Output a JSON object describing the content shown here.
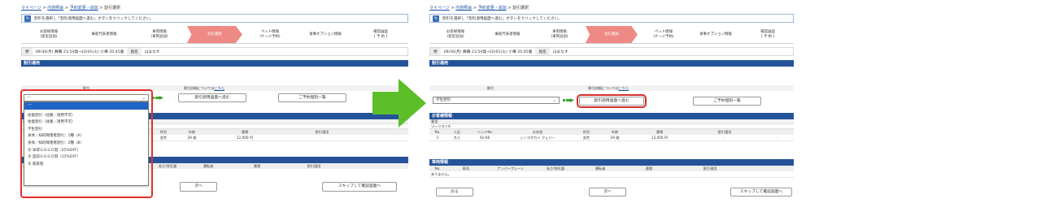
{
  "breadcrumb": {
    "items": [
      "マイページ",
      "内容照会",
      "予約変更・追加",
      "割引選択"
    ],
    "separator": ">"
  },
  "notice": "割引を選択し「割引適用画面へ進む」ボタンをクリックしてください。",
  "steps": [
    {
      "line1": "お客様情報",
      "line2": "(客室追加)"
    },
    {
      "line1": "乗船代表者情報",
      "line2": ""
    },
    {
      "line1": "車両情報",
      "line2": "(車両追加)"
    },
    {
      "line1": "割引選択",
      "line2": ""
    },
    {
      "line1": "ペット情報",
      "line2": "(ケージ予約)"
    },
    {
      "line1": "食事オプション情報",
      "line2": ""
    },
    {
      "line1": "確認画面",
      "line2": "[ 予 約 ]"
    }
  ],
  "trip": {
    "label": "便",
    "schedule": "09/30(月) 舞鶴 23:50発→10/01(火) 小樽 20:45着",
    "ship_label": "船名",
    "ship_name": "はまなす"
  },
  "discount_section": {
    "title": "割引適用",
    "col_discount": "割引",
    "detail_text": "割引詳細については",
    "detail_link": "こちら",
    "apply_button": "割引適用画面へ進む",
    "list_button": "ご予約個別一覧",
    "left_select_value": "---",
    "right_select_value": "学生割引"
  },
  "dropdown_options": [
    "---",
    "往復割引（往路／適用不可）",
    "往復割引（往路／適用不可）",
    "学生割引",
    "身体／知的障害者割引：1種（A）",
    "身体／知的障害者割引：2種（B）",
    "㊟ 早得ＧＯＧＯ割（25%OFF）",
    "㊟ 直前ＧＯＧＯ割（15%OFF）",
    "㊟ 家族割"
  ],
  "customer_section": {
    "title": "お客様情報",
    "room_label": "客室",
    "room_type": "ツーリストA",
    "headers": [
      "No.",
      "人区",
      "ベッドNo",
      "お名前",
      "性別",
      "年齢",
      "運賃",
      "割引適用"
    ],
    "rows": [
      [
        "1",
        "大人",
        "A2-66",
        "シンコホカイ フェリー",
        "女性",
        "29 歳",
        "12,000 円",
        "-",
        "-"
      ]
    ]
  },
  "vehicle_section": {
    "title": "車両情報",
    "headers": [
      "No.",
      "車両",
      "ナンバープレート",
      "長さ/排気量",
      "運転者",
      "運賃",
      "割引適用"
    ],
    "empty_text": "ありません。"
  },
  "footer": {
    "back_button": "戻る",
    "next_button": "次へ",
    "skip_button": "スキップして確認画面へ"
  },
  "colors": {
    "section_header": "#25539a",
    "active_step": "#ee8a86",
    "highlight": "#e3302c",
    "arrow": "#5cbf2a",
    "selected_option": "#1e63c6"
  }
}
